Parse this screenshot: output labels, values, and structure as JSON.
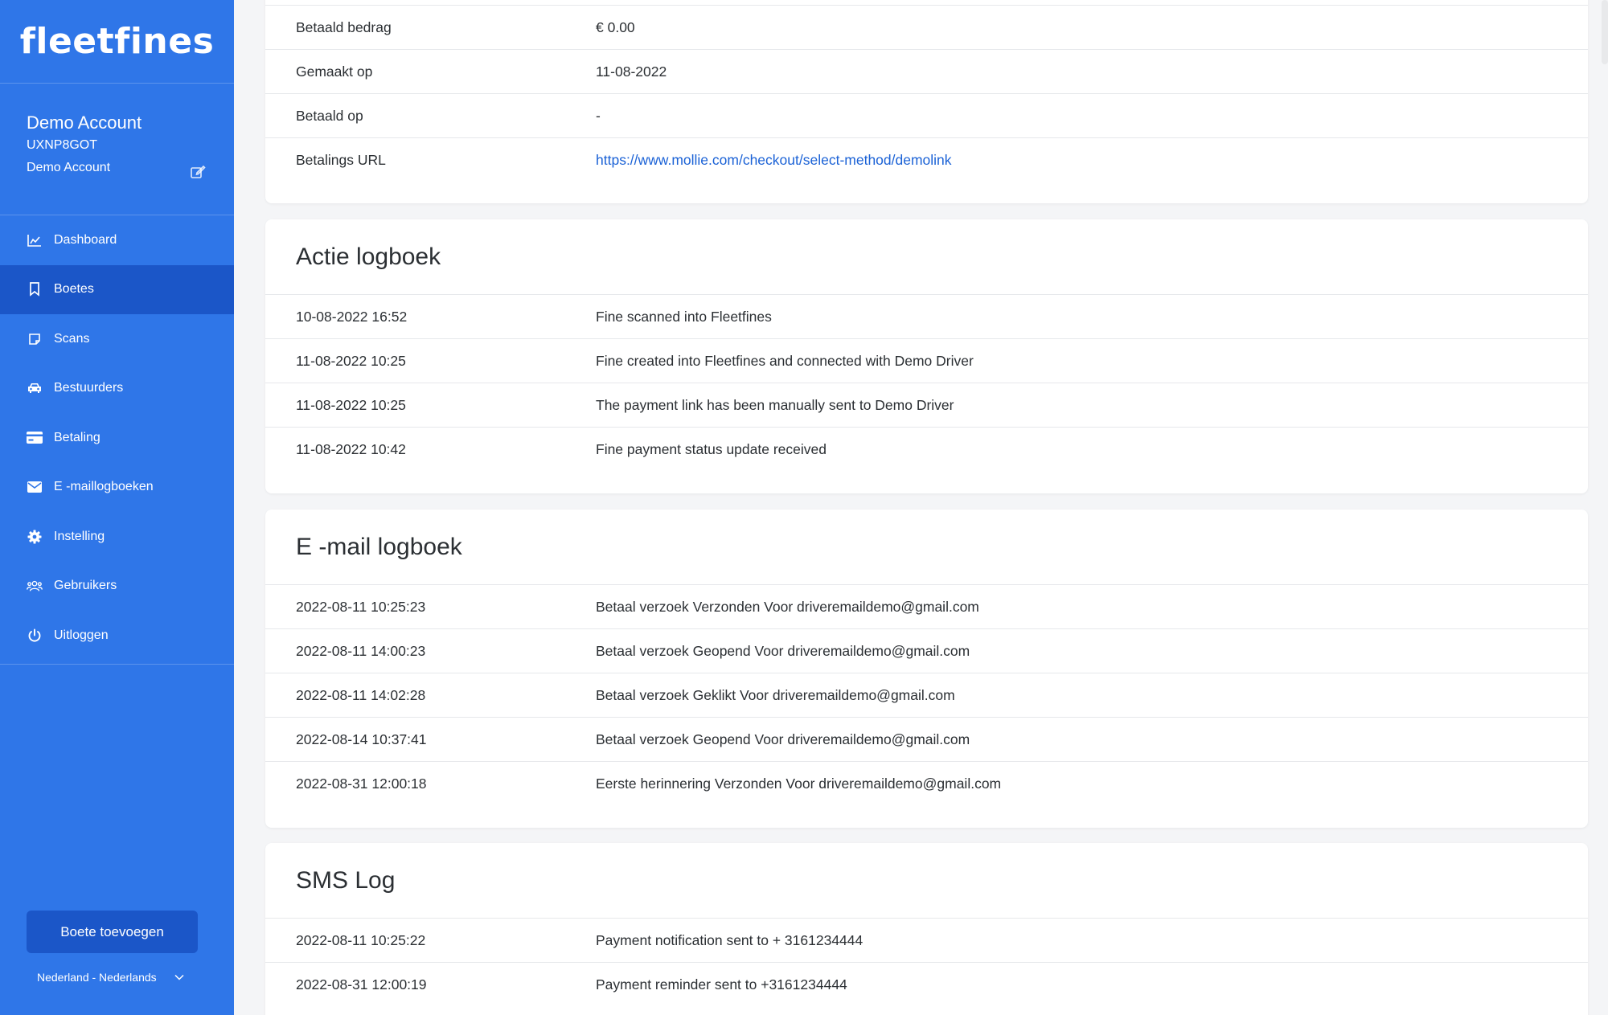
{
  "brand": {
    "logo_text": "fleetfines",
    "color": "#2f76e8",
    "active_color": "#1b56c8"
  },
  "account": {
    "name": "Demo Account",
    "code": "UXNP8GOT",
    "subtitle": "Demo Account",
    "edit_icon": "edit-icon"
  },
  "nav": {
    "items": [
      {
        "label": "Dashboard",
        "icon": "chart-icon"
      },
      {
        "label": "Boetes",
        "icon": "bookmark-icon",
        "active": true
      },
      {
        "label": "Scans",
        "icon": "scan-icon"
      },
      {
        "label": "Bestuurders",
        "icon": "car-icon"
      },
      {
        "label": "Betaling",
        "icon": "credit-card-icon"
      },
      {
        "label": "E -maillogboeken",
        "icon": "envelope-icon"
      },
      {
        "label": "Instelling",
        "icon": "gear-icon"
      },
      {
        "label": "Gebruikers",
        "icon": "users-icon"
      },
      {
        "label": "Uitloggen",
        "icon": "power-icon"
      }
    ]
  },
  "add_button": {
    "label": "Boete toevoegen"
  },
  "language": {
    "selected": "Nederland - Nederlands"
  },
  "payment_details": {
    "rows": [
      {
        "label": "Betaald bedrag",
        "value": "€ 0.00"
      },
      {
        "label": "Gemaakt op",
        "value": "11-08-2022"
      },
      {
        "label": "Betaald op",
        "value": "-"
      },
      {
        "label": "Betalings URL",
        "value": "https://www.mollie.com/checkout/select-method/demolink"
      }
    ]
  },
  "action_log": {
    "title": "Actie logboek",
    "rows": [
      {
        "time": "10-08-2022 16:52",
        "text": "Fine scanned into Fleetfines"
      },
      {
        "time": "11-08-2022 10:25",
        "text": "Fine created into Fleetfines and connected with Demo Driver"
      },
      {
        "time": "11-08-2022 10:25",
        "text": "The payment link has been manually sent to Demo Driver"
      },
      {
        "time": "11-08-2022 10:42",
        "text": "Fine payment status update received"
      }
    ]
  },
  "email_log": {
    "title": "E -mail logboek",
    "rows": [
      {
        "time": "2022-08-11 10:25:23",
        "text": "Betaal verzoek Verzonden Voor driveremaildemo@gmail.com"
      },
      {
        "time": "2022-08-11 14:00:23",
        "text": "Betaal verzoek Geopend Voor driveremaildemo@gmail.com"
      },
      {
        "time": "2022-08-11 14:02:28",
        "text": "Betaal verzoek Geklikt Voor driveremaildemo@gmail.com"
      },
      {
        "time": "2022-08-14 10:37:41",
        "text": "Betaal verzoek Geopend Voor driveremaildemo@gmail.com"
      },
      {
        "time": "2022-08-31 12:00:18",
        "text": "Eerste herinnering Verzonden Voor driveremaildemo@gmail.com"
      }
    ]
  },
  "sms_log": {
    "title": "SMS Log",
    "rows": [
      {
        "time": "2022-08-11 10:25:22",
        "text": "Payment notification sent to + 3161234444"
      },
      {
        "time": "2022-08-31 12:00:19",
        "text": "Payment reminder sent to +3161234444"
      }
    ]
  }
}
